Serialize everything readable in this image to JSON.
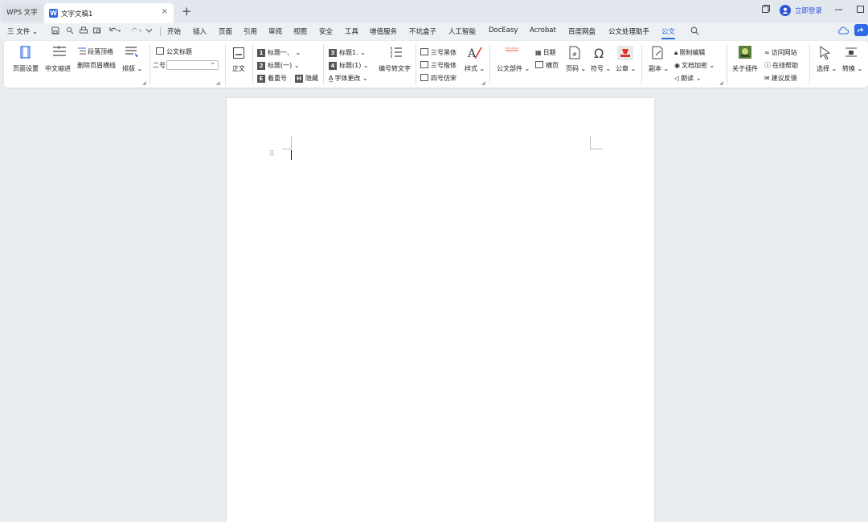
{
  "titlebar": {
    "home_tab": "WPS 文字",
    "doc_tab": "文字文稿1",
    "doc_logo": "W",
    "close_glyph": "×",
    "add_glyph": "+",
    "login": "立即登录"
  },
  "menubar": {
    "file": "三 文件 ⌄",
    "items": [
      "开始",
      "插入",
      "页面",
      "引用",
      "审阅",
      "视图",
      "安全",
      "工具",
      "增值服务",
      "不坑盒子",
      "人工智能",
      "DocEasy",
      "Acrobat",
      "百度网盘",
      "公文处理助手",
      "公文"
    ],
    "active": "公文"
  },
  "ribbon": {
    "page_setup": "页面设置",
    "cn_indent": "中文缩进",
    "para_top": "段落顶格",
    "del_header_line": "删除页眉横线",
    "layout": "排版 ⌄",
    "doc_title": "公文标题",
    "size_label": "二号",
    "body_text": "正文",
    "heading1": "标题一、 ⌄",
    "heading2": "标题(一) ⌄",
    "emphasis": "着重号",
    "hide": "隐藏",
    "heading3": "标题1. ⌄",
    "heading4": "标题(1) ⌄",
    "font_change": "字体更改 ⌄",
    "num_to_text": "编号转文字",
    "hei3": "三号黑体",
    "kai3": "三号楷体",
    "fangsong4": "四号仿宋",
    "style": "样式 ⌄",
    "doc_parts": "公文部件 ⌄",
    "date": "日期",
    "landscape": "横页",
    "page_num": "页码 ⌄",
    "symbol": "符号 ⌄",
    "seal": "公章 ⌄",
    "copy": "副本 ⌄",
    "restrict_edit": "限制编辑",
    "doc_encrypt": "文档加密 ⌄",
    "read_aloud": "朗读 ⌄",
    "about_plugin": "关于插件",
    "visit_site": "访问网站",
    "online_help": "在线帮助",
    "feedback": "建议反馈",
    "select": "选择 ⌄",
    "convert": "转换 ⌄",
    "nums": [
      "1",
      "2",
      "3",
      "4"
    ],
    "e_mark": "E",
    "h_mark": "H"
  },
  "colors": {
    "accent": "#2f6be4",
    "seal_red": "#d9342b"
  }
}
